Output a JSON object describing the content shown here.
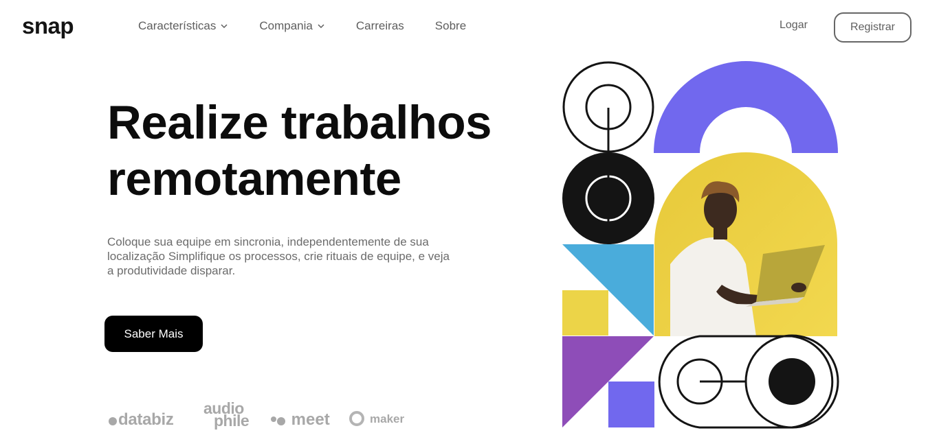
{
  "header": {
    "logo": "snap",
    "nav": [
      {
        "label": "Características",
        "has_dropdown": true
      },
      {
        "label": "Compania",
        "has_dropdown": true
      },
      {
        "label": "Carreiras",
        "has_dropdown": false
      },
      {
        "label": "Sobre",
        "has_dropdown": false
      }
    ],
    "login_label": "Logar",
    "register_label": "Registrar"
  },
  "hero": {
    "title_line1": "Realize trabalhos",
    "title_line2": "remotamente",
    "description": "Coloque sua equipe em sincronia, independentemente de sua localização Simplifique os processos, crie rituais de equipe, e veja a produtividade disparar.",
    "cta_label": "Saber Mais"
  },
  "clients": {
    "databiz": "databiz",
    "audiophile_top": "audio",
    "audiophile_bottom": "phile",
    "meet": "meet",
    "maker": "maker"
  },
  "colors": {
    "purple": "#7168EE",
    "yellow": "#ECD448",
    "blue": "#4AACDB",
    "violet": "#8E4DB8",
    "dark": "#141414"
  },
  "icons": {
    "chevron": "chevron-down-icon",
    "photo": "person-with-laptop-photo"
  }
}
